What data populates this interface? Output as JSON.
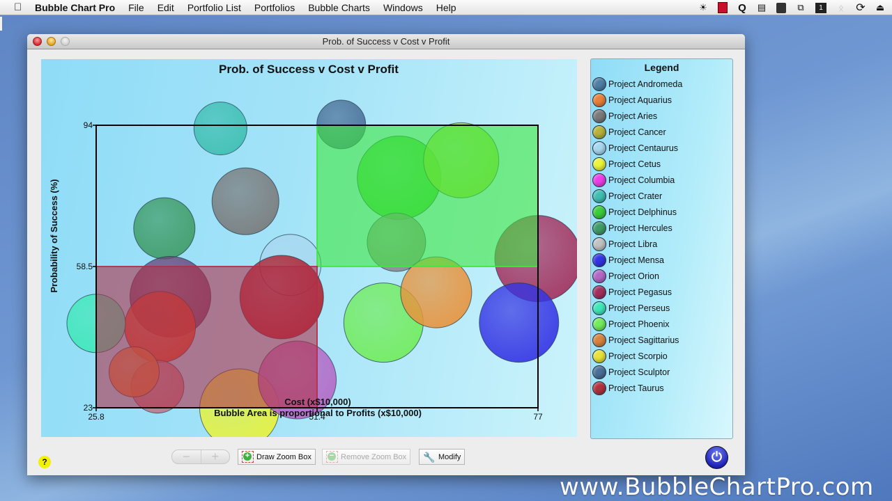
{
  "menubar": {
    "app_name": "Bubble Chart Pro",
    "items": [
      "File",
      "Edit",
      "Portfolio List",
      "Portfolios",
      "Bubble Charts",
      "Windows",
      "Help"
    ],
    "status_icons": [
      "brightness-icon",
      "red-flag-icon",
      "q-icon",
      "globe-icon",
      "lock-icon",
      "window-switch-icon",
      "spaces-icon",
      "bluetooth-icon",
      "sync-icon",
      "eject-icon"
    ]
  },
  "window": {
    "title": "Prob. of Success v Cost v Profit"
  },
  "legend": {
    "title": "Legend",
    "items": [
      {
        "label": "Project Andromeda",
        "color": "#4f7fa6"
      },
      {
        "label": "Project Aquarius",
        "color": "#e8803a"
      },
      {
        "label": "Project Aries",
        "color": "#7a7a7a"
      },
      {
        "label": "Project Cancer",
        "color": "#b8b23a"
      },
      {
        "label": "Project Centaurus",
        "color": "#a8d8f0"
      },
      {
        "label": "Project Cetus",
        "color": "#eaf53a"
      },
      {
        "label": "Project Columbia",
        "color": "#ee3ee8"
      },
      {
        "label": "Project Crater",
        "color": "#3fbfb2"
      },
      {
        "label": "Project Delphinus",
        "color": "#3ccd3a"
      },
      {
        "label": "Project Hercules",
        "color": "#3f9c66"
      },
      {
        "label": "Project Libra",
        "color": "#c2c2c2"
      },
      {
        "label": "Project Mensa",
        "color": "#3434e4"
      },
      {
        "label": "Project Orion",
        "color": "#b468c6"
      },
      {
        "label": "Project Pegasus",
        "color": "#a2305e"
      },
      {
        "label": "Project Perseus",
        "color": "#3fe8b8"
      },
      {
        "label": "Project Phoenix",
        "color": "#72ec5c"
      },
      {
        "label": "Project Sagittarius",
        "color": "#d8843e"
      },
      {
        "label": "Project Scorpio",
        "color": "#e8e23a"
      },
      {
        "label": "Project Sculptor",
        "color": "#4b6f98"
      },
      {
        "label": "Project Taurus",
        "color": "#b0323e"
      }
    ]
  },
  "toolbar": {
    "help_label": "?",
    "zoom_out_label": "−",
    "zoom_in_label": "+",
    "draw_zoom_box_label": "Draw Zoom Box",
    "remove_zoom_box_label": "Remove Zoom Box",
    "modify_label": "Modify"
  },
  "watermark": "www.BubbleChartPro.com",
  "chart_data": {
    "type": "scatter",
    "subtype": "bubble",
    "title": "Prob. of Success v Cost v Profit",
    "xlabel": "Cost (x$10,000)",
    "subtitle": "Bubble Area is proportional to Profits (x$10,000)",
    "ylabel": "Probability of Success (%)",
    "xlim": [
      25.8,
      77
    ],
    "ylim": [
      23,
      94
    ],
    "x_ticks": [
      25.8,
      51.4,
      77
    ],
    "y_ticks": [
      23,
      58.5,
      94
    ],
    "x_tick_labels": [
      "25.8",
      "51.4",
      "77"
    ],
    "y_tick_labels": [
      "23",
      "58.5",
      "94"
    ],
    "grid": false,
    "legend_position": "right",
    "quadrant_boxes": [
      {
        "name": "high-probability-high-cost",
        "x": [
          51.4,
          77
        ],
        "y": [
          58.5,
          94
        ],
        "color": "#3ee83e"
      },
      {
        "name": "low-probability-low-cost",
        "x": [
          25.8,
          51.4
        ],
        "y": [
          23,
          58.5
        ],
        "color": "#b0304a"
      }
    ],
    "series": [
      {
        "name": "Project Crater",
        "x": 40.2,
        "y": 93.2,
        "size": 3.8,
        "color": "#3fbfb2"
      },
      {
        "name": "Project Sculptor",
        "x": 54.2,
        "y": 94.2,
        "size": 3.5,
        "color": "#4b6f98"
      },
      {
        "name": "Project Aries",
        "x": 43.1,
        "y": 74.9,
        "size": 4.8,
        "color": "#7a7a7a"
      },
      {
        "name": "Project Hercules",
        "x": 33.7,
        "y": 68.1,
        "size": 4.4,
        "color": "#3f9c66"
      },
      {
        "name": "Project Delphinus",
        "x": 60.9,
        "y": 80.8,
        "size": 6.0,
        "color": "#3ccd3a"
      },
      {
        "name": "Project Cancer",
        "x": 68.1,
        "y": 85.2,
        "size": 5.4,
        "color": "#9bd83a"
      },
      {
        "name": "Project Libra",
        "x": 60.6,
        "y": 64.6,
        "size": 4.2,
        "color": "#8a8a90"
      },
      {
        "name": "Project Pegasus",
        "x": 77.0,
        "y": 60.5,
        "size": 6.2,
        "color": "#a2305e"
      },
      {
        "name": "Project Centaurus",
        "x": 48.3,
        "y": 58.9,
        "size": 4.4,
        "color": "#a8d8f0"
      },
      {
        "name": "Project Andromeda",
        "x": 34.4,
        "y": 50.9,
        "size": 5.8,
        "color": "#6a4a78"
      },
      {
        "name": "Project Taurus",
        "x": 47.3,
        "y": 50.8,
        "size": 6.0,
        "color": "#b0202e"
      },
      {
        "name": "Project Sagittarius",
        "x": 33.2,
        "y": 43.3,
        "size": 5.1,
        "color": "#d84a2a"
      },
      {
        "name": "Project Perseus",
        "x": 25.8,
        "y": 44.2,
        "size": 4.2,
        "color": "#3fe8b8"
      },
      {
        "name": "Project Columbia",
        "x": 32.9,
        "y": 28.3,
        "size": 3.8,
        "color": "#b97a8a"
      },
      {
        "name": "Project Aquarius",
        "x": 30.2,
        "y": 32.0,
        "size": 3.6,
        "color": "#d8843e"
      },
      {
        "name": "Project Scorpio",
        "x": 42.4,
        "y": 22.8,
        "size": 5.7,
        "color": "#e8f23a"
      },
      {
        "name": "Project Orion",
        "x": 49.1,
        "y": 30.0,
        "size": 5.6,
        "color": "#b468c6"
      },
      {
        "name": "Project Phoenix",
        "x": 59.1,
        "y": 44.4,
        "size": 5.7,
        "color": "#72ec5c"
      },
      {
        "name": "Project Cetus",
        "x": 65.2,
        "y": 52.0,
        "size": 5.1,
        "color": "#e8943e"
      },
      {
        "name": "Project Mensa",
        "x": 74.8,
        "y": 44.4,
        "size": 5.7,
        "color": "#3434e4"
      }
    ]
  }
}
